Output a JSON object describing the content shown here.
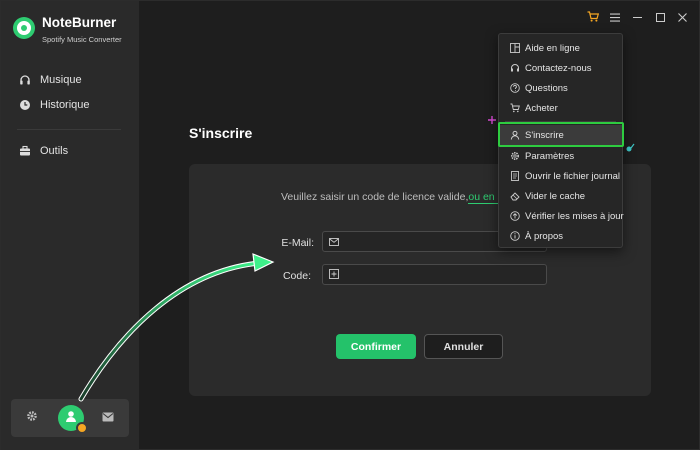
{
  "app": {
    "name": "NoteBurner",
    "subtitle": "Spotify Music Converter"
  },
  "sidebar": {
    "items": [
      {
        "label": "Musique",
        "icon": "headphones-icon"
      },
      {
        "label": "Historique",
        "icon": "clock-icon"
      },
      {
        "label": "Outils",
        "icon": "toolbox-icon"
      }
    ],
    "bottom": {
      "settings_icon": "gear-icon",
      "account_icon": "user-icon",
      "mail_icon": "mail-icon"
    }
  },
  "titlebar": {
    "icons": [
      "cart-icon",
      "menu-icon",
      "minimize-icon",
      "maximize-icon",
      "close-icon"
    ]
  },
  "main": {
    "title": "S'inscrire",
    "hint_text": "Veuillez saisir un code de licence valide,",
    "hint_link": "ou en achete",
    "email_label": "E-Mail:",
    "email_value": "",
    "code_label": "Code:",
    "code_value": "",
    "confirm_label": "Confirmer",
    "cancel_label": "Annuler"
  },
  "menu": {
    "items": [
      {
        "label": "Aide en ligne",
        "icon": "book-icon"
      },
      {
        "label": "Contactez-nous",
        "icon": "headset-icon"
      },
      {
        "label": "Questions",
        "icon": "question-icon"
      },
      {
        "label": "Acheter",
        "icon": "cart-icon"
      },
      {
        "label": "S'inscrire",
        "icon": "user-icon",
        "active": true
      },
      {
        "label": "Paramètres",
        "icon": "gear-icon"
      },
      {
        "label": "Ouvrir le fichier journal",
        "icon": "file-icon"
      },
      {
        "label": "Vider le cache",
        "icon": "eraser-icon"
      },
      {
        "label": "Vérifier les mises à jour",
        "icon": "update-icon"
      },
      {
        "label": "À propos",
        "icon": "info-icon"
      }
    ]
  },
  "colors": {
    "accent": "#2ecc71",
    "highlight_border": "#2ecc40",
    "badge": "#f5a623"
  }
}
